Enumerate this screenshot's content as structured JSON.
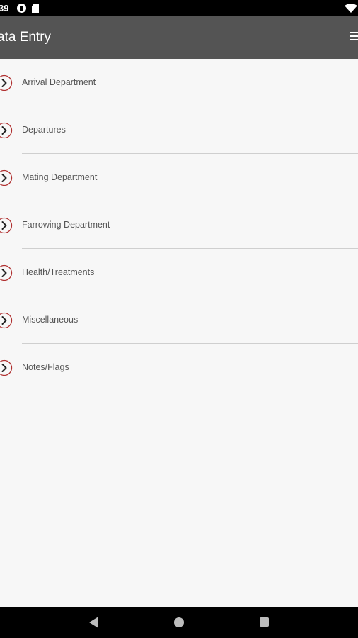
{
  "status_bar": {
    "time": "39",
    "icons": [
      "p-badge-icon",
      "sd-card-icon",
      "wifi-icon"
    ]
  },
  "app_bar": {
    "title": "ata Entry",
    "menu_icon": "hamburger-menu-icon"
  },
  "menu": {
    "items": [
      {
        "label": "Arrival Department",
        "icon": "chevron-right-circle-icon"
      },
      {
        "label": "Departures",
        "icon": "chevron-right-circle-icon"
      },
      {
        "label": "Mating Department",
        "icon": "chevron-right-circle-icon"
      },
      {
        "label": "Farrowing Department",
        "icon": "chevron-right-circle-icon"
      },
      {
        "label": "Health/Treatments",
        "icon": "chevron-right-circle-icon"
      },
      {
        "label": "Miscellaneous",
        "icon": "chevron-right-circle-icon"
      },
      {
        "label": "Notes/Flags",
        "icon": "chevron-right-circle-icon"
      }
    ]
  },
  "nav_bar": {
    "buttons": [
      "back-icon",
      "home-icon",
      "recent-apps-icon"
    ]
  },
  "colors": {
    "app_bar": "#545454",
    "accent": "#b03030",
    "background": "#f7f7f7"
  }
}
